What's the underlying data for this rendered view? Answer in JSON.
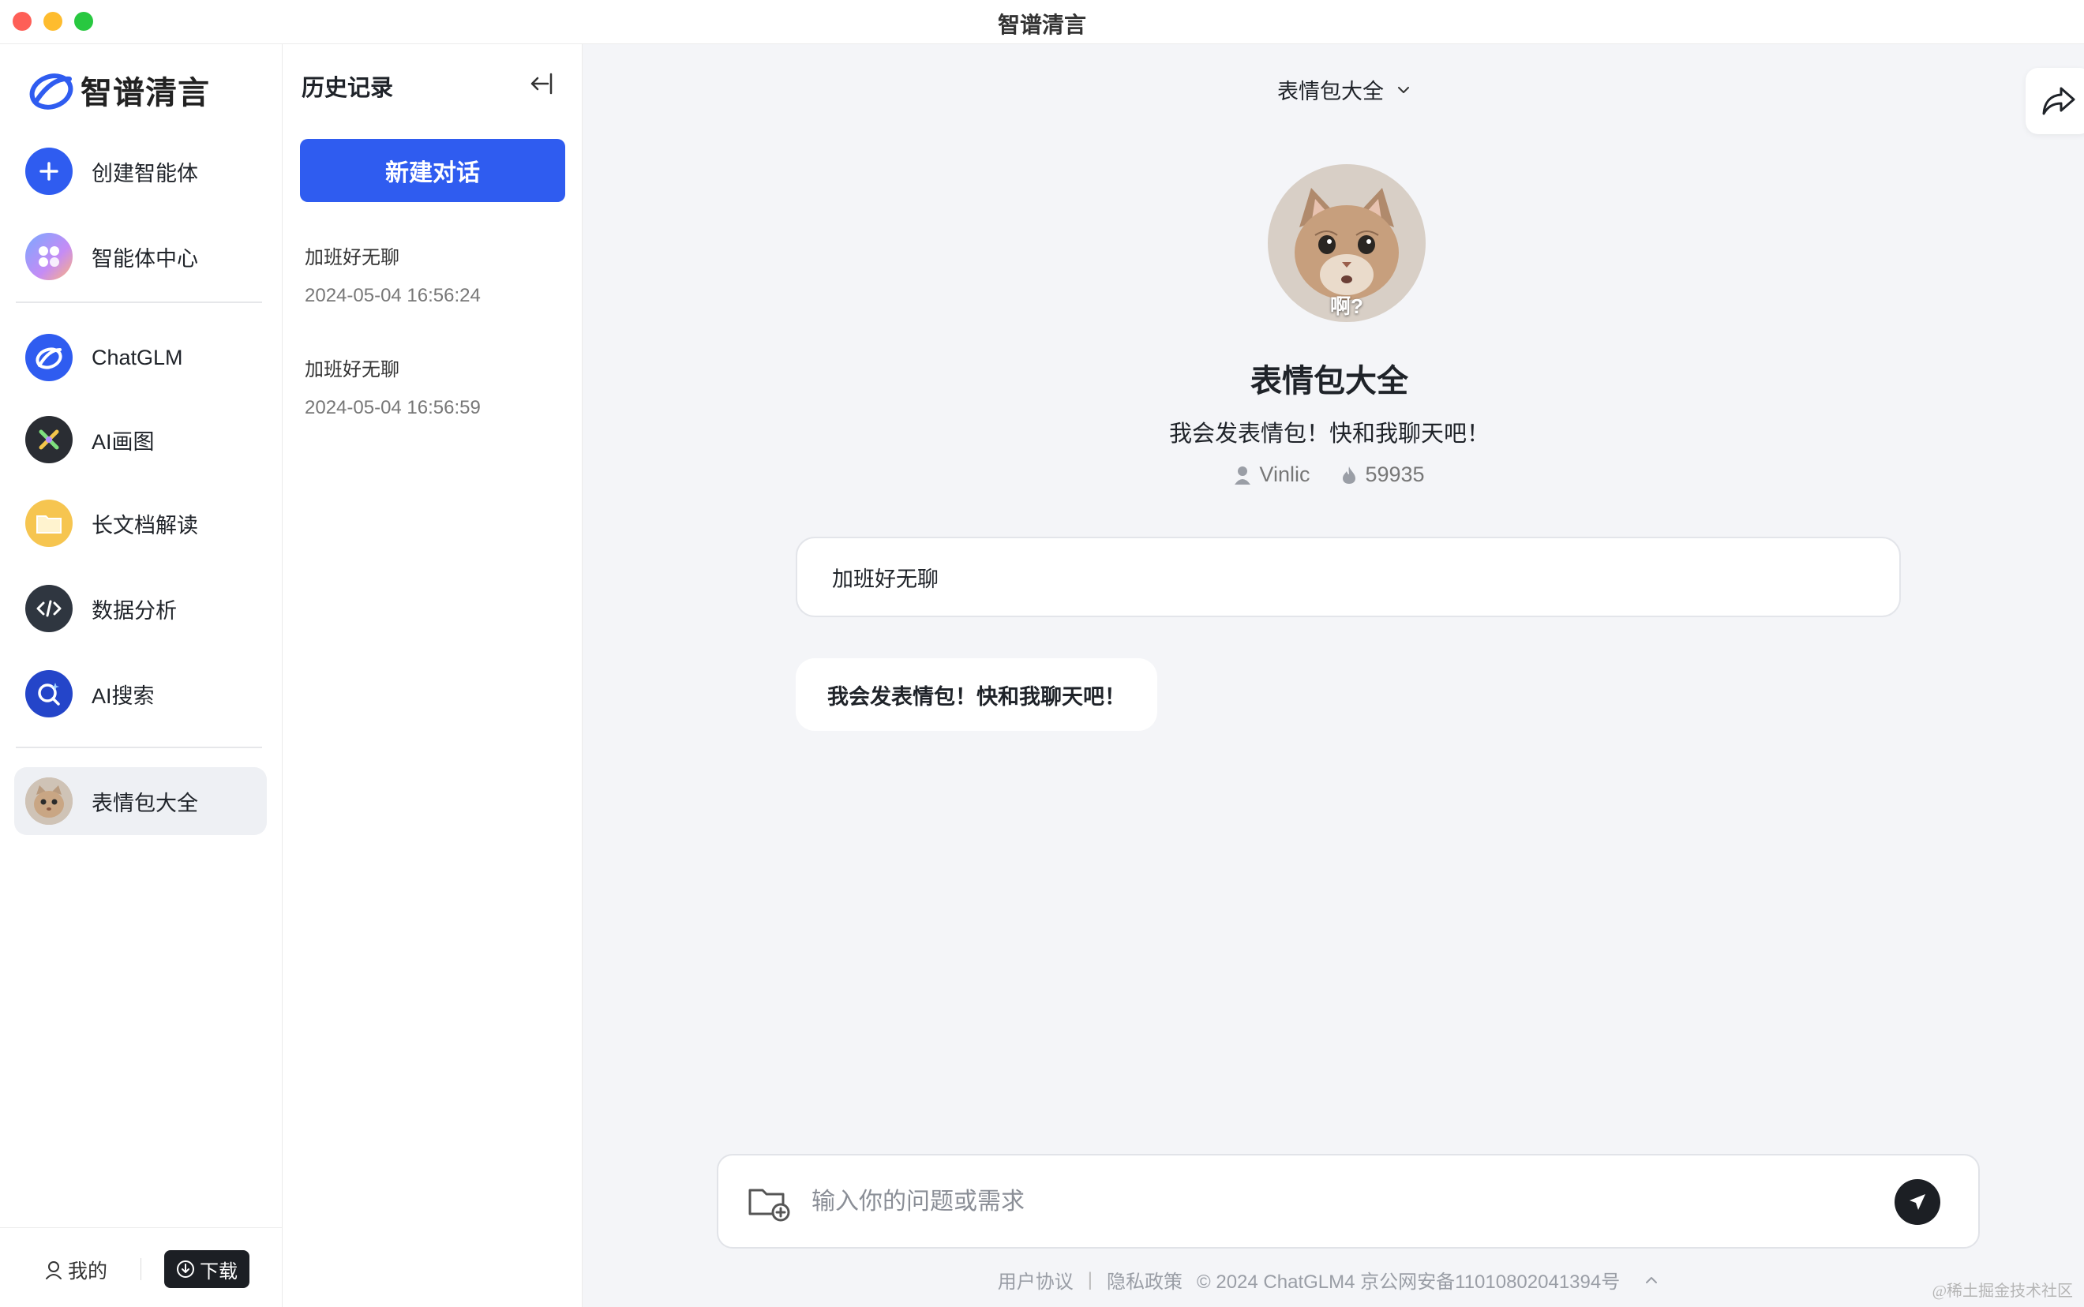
{
  "window": {
    "title": "智谱清言"
  },
  "nav": {
    "logo_text": "智谱清言",
    "items": [
      {
        "label": "创建智能体",
        "icon": "plus-icon"
      },
      {
        "label": "智能体中心",
        "icon": "grid-dots-icon"
      },
      {
        "label": "ChatGLM",
        "icon": "chatglm-logo-icon"
      },
      {
        "label": "AI画图",
        "icon": "ai-drawing-icon"
      },
      {
        "label": "长文档解读",
        "icon": "folder-icon"
      },
      {
        "label": "数据分析",
        "icon": "code-icon"
      },
      {
        "label": "AI搜索",
        "icon": "search-sparkle-icon"
      },
      {
        "label": "表情包大全",
        "icon": "cat-avatar",
        "active": true
      }
    ],
    "me_label": "我的",
    "download_label": "下载"
  },
  "history": {
    "title": "历史记录",
    "new_chat_label": "新建对话",
    "items": [
      {
        "title": "加班好无聊",
        "time": "2024-05-04 16:56:24"
      },
      {
        "title": "加班好无聊",
        "time": "2024-05-04 16:56:59"
      }
    ]
  },
  "chat": {
    "bot_dropdown_label": "表情包大全",
    "bot_avatar_caption": "啊?",
    "bot_name": "表情包大全",
    "bot_desc": "我会发表情包！快和我聊天吧！",
    "bot_author": "Vinlic",
    "bot_heat": "59935",
    "messages": [
      {
        "role": "user",
        "text": "加班好无聊"
      },
      {
        "role": "assistant",
        "text": "我会发表情包！快和我聊天吧！"
      }
    ],
    "input_placeholder": "输入你的问题或需求"
  },
  "footer": {
    "terms": "用户协议",
    "privacy": "隐私政策",
    "copyright": "© 2024 ChatGLM4 京公网安备11010802041394号"
  },
  "corner_watermark": "@稀土掘金技术社区",
  "colors": {
    "accent": "#2f5cf0",
    "dark_button": "#1c1f24",
    "background": "#f4f5f8"
  }
}
